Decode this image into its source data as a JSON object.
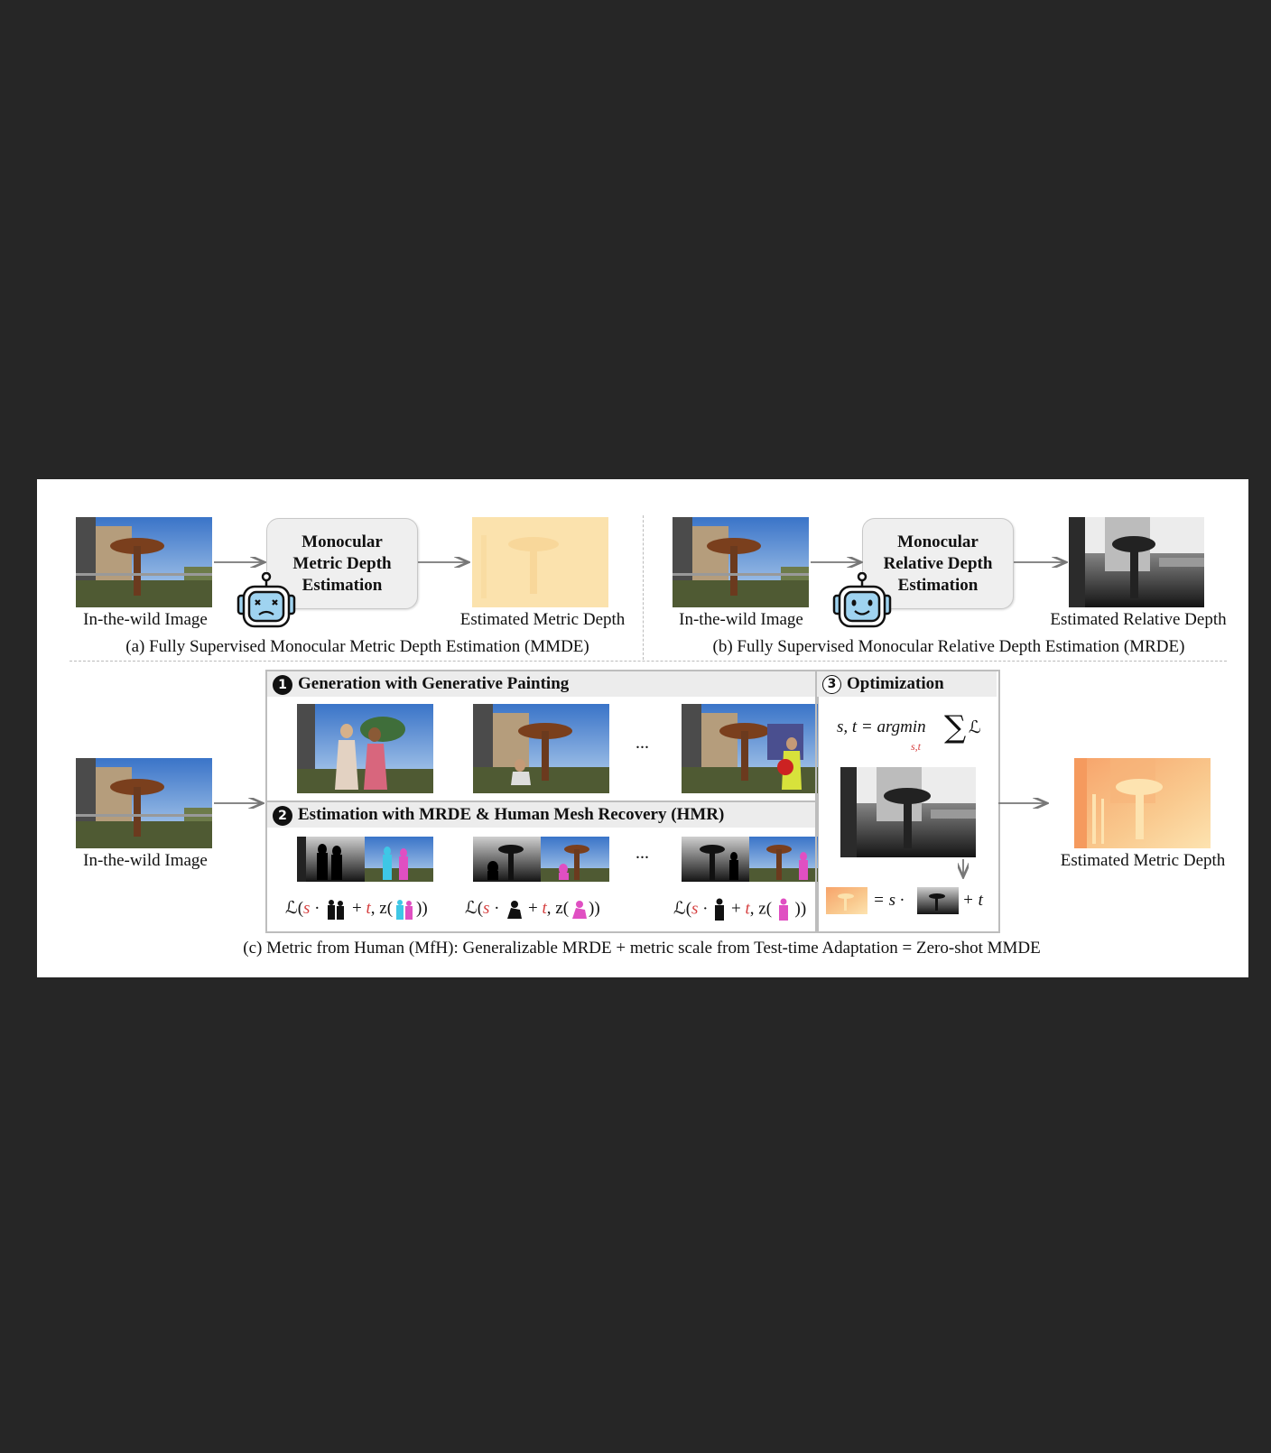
{
  "panel_a": {
    "input_label": "In-the-wild Image",
    "box_lines": [
      "Monocular",
      "Metric Depth",
      "Estimation"
    ],
    "output_label": "Estimated Metric Depth",
    "caption": "(a) Fully Supervised Monocular Metric Depth Estimation (MMDE)"
  },
  "panel_b": {
    "input_label": "In-the-wild Image",
    "box_lines": [
      "Monocular",
      "Relative Depth",
      "Estimation"
    ],
    "output_label": "Estimated Relative Depth",
    "caption": "(b) Fully Supervised Monocular Relative Depth Estimation (MRDE)"
  },
  "panel_c": {
    "input_label": "In-the-wild Image",
    "step1_num": "1",
    "step1_title": "Generation with Generative Painting",
    "step2_num": "2",
    "step2_title": "Estimation with MRDE & Human Mesh Recovery (HMR)",
    "step3_num": "3",
    "step3_title": "Optimization",
    "ellipsis": "...",
    "loss_symbol": "ℒ",
    "s": "s",
    "t": "t",
    "z": "z",
    "argmin_lhs": "s, t = argmin",
    "argmin_sub": "s,t",
    "sum_symbol": "∑",
    "eq_s": "= s ·",
    "plus_t": "+ t",
    "output_label": "Estimated Metric Depth",
    "caption": "(c) Metric from Human (MfH): Generalizable MRDE + metric scale from Test-time Adaptation = Zero-shot MMDE"
  },
  "colors": {
    "background": "#262626",
    "figure_bg": "#ffffff",
    "box_bg": "#efefef",
    "loss_param": "#d64040",
    "robot_face": "#9fd3f0",
    "human_blue": "#3ec7e6",
    "human_pink": "#e04fc2"
  },
  "icons": {
    "robot_sad": "robot-sad-icon",
    "robot_happy": "robot-happy-icon"
  }
}
